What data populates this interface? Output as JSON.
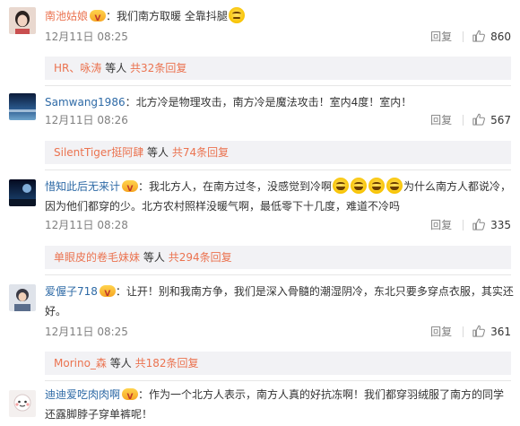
{
  "comments": [
    {
      "user": "南池姑娘",
      "text": "：我们南方取暖 全靠抖腿",
      "date": "12月11日 08:25",
      "reply_label": "回复",
      "likes": "860",
      "reply_names": "HR、咏涛",
      "reply_mid": "等人",
      "reply_total": "共32条回复"
    },
    {
      "user": "Samwang1986",
      "text": "：北方冷是物理攻击，南方冷是魔法攻击！室内4度！室内！",
      "date": "12月11日 08:26",
      "reply_label": "回复",
      "likes": "567",
      "reply_names": "SilentTiger挺阿肆",
      "reply_mid": "等人",
      "reply_total": "共74条回复"
    },
    {
      "user": "惜知此后无来计",
      "text_a": "：我北方人，在南方过冬，没感觉到冷啊",
      "text_b": "为什么南方人都说冷，",
      "text_c": "因为他们都穿的少。北方农村照样没暖气啊，最低零下十几度，难道不冷吗",
      "date": "12月11日 08:28",
      "reply_label": "回复",
      "likes": "335",
      "reply_names": "单眼皮的卷毛妹妹",
      "reply_mid": "等人",
      "reply_total": "共294条回复"
    },
    {
      "user": "爱偓子718",
      "text_a": "：让开！别和我南方争，我们是深入骨髓的潮湿阴冷，东北只要多穿点衣服，其实还",
      "text_b": "好。",
      "date": "12月11日 08:25",
      "reply_label": "回复",
      "likes": "361",
      "reply_names": "Morino_森",
      "reply_mid": "等人",
      "reply_total": "共182条回复"
    },
    {
      "user": "迪迪爱吃肉肉啊",
      "text_a": "：作为一个北方人表示，南方人真的好抗冻啊！我们都穿羽绒服了南方的同学",
      "text_b": "还露脚脖子穿单裤呢！"
    }
  ],
  "colors": {
    "username": "#eb7350",
    "link_blue": "#2e6aa6",
    "reply_bg": "#f2f2f5"
  },
  "icons": {
    "like": "thumbs-up-icon",
    "badge": "v-badge-icon",
    "emoji_doubt": "doubt-emoji-icon",
    "emoji_laugh": "laugh-cry-emoji-icon"
  }
}
